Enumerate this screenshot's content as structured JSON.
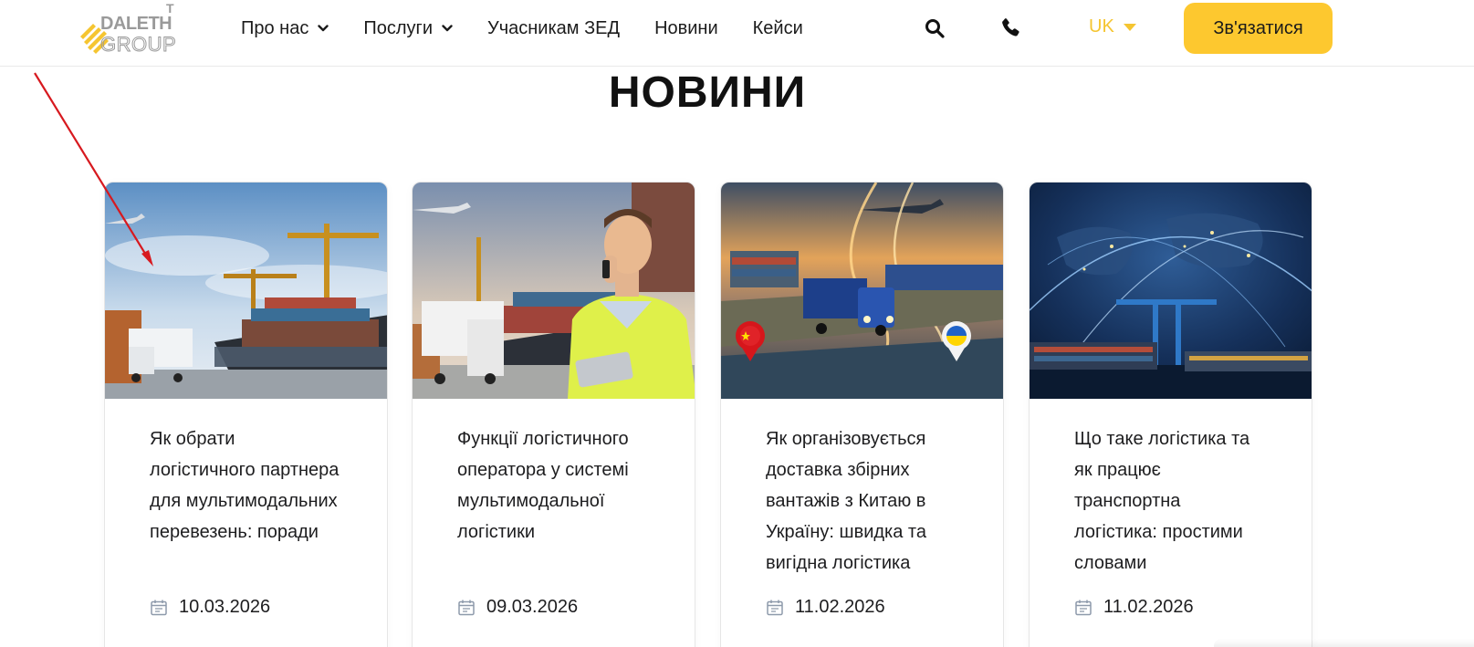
{
  "brand": {
    "logo_text_top": "DALETH",
    "logo_text_bottom": "GROUP",
    "logo_mark": "T",
    "accent": "#fdc82f",
    "lang_color": "#f5c531"
  },
  "nav": {
    "items": [
      {
        "label": "Про нас",
        "has_dropdown": true
      },
      {
        "label": "Послуги",
        "has_dropdown": true
      },
      {
        "label": "Учасникам ЗЕД",
        "has_dropdown": false
      },
      {
        "label": "Новини",
        "has_dropdown": false
      },
      {
        "label": "Кейси",
        "has_dropdown": false
      }
    ],
    "search_icon": "search-icon",
    "phone_icon": "phone-icon",
    "language": "UK",
    "contact_label": "Зв'язатися"
  },
  "page": {
    "title": "НОВИНИ"
  },
  "cards": [
    {
      "title": "Як обрати логістичного партнера для мультимодальних перевезень: поради",
      "date": "10.03.2026",
      "image": "port-truck-ship"
    },
    {
      "title": "Функції логістичного оператора у системі мультимодальної логістики",
      "date": "09.03.2026",
      "image": "man-phone-port"
    },
    {
      "title": "Як організовується доставка збірних вантажів з Китаю в Україну: швидка та вигідна логістика",
      "date": "11.02.2026",
      "image": "china-ukraine-route"
    },
    {
      "title": "Що таке логістика та як працює транспортна логістика: простими словами",
      "date": "11.02.2026",
      "image": "world-network-port"
    }
  ]
}
